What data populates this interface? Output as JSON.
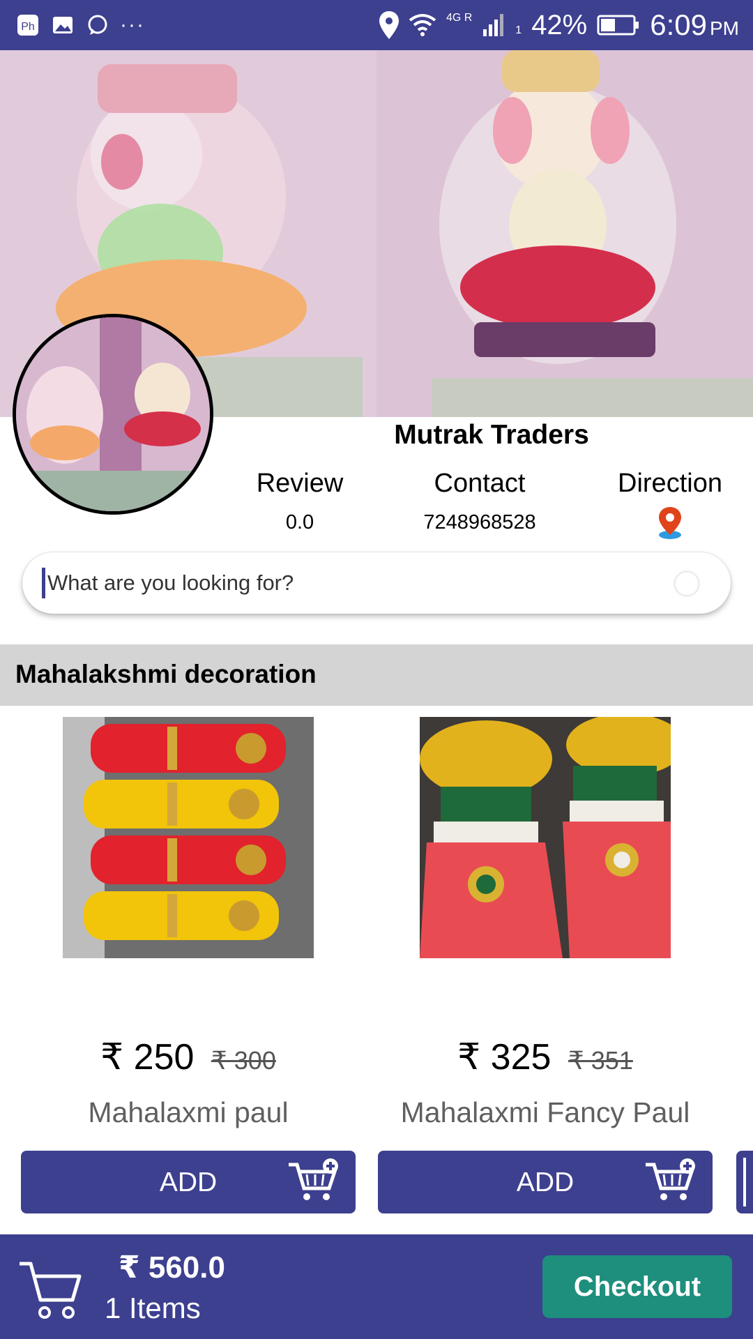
{
  "status_bar": {
    "network": "4G R",
    "sim_slot": "1",
    "battery": "42%",
    "time": "6:09",
    "ampm": "PM",
    "left_icons": [
      "photo-icon",
      "image-icon",
      "whatsapp-icon",
      "more-dots-icon"
    ],
    "more": "···"
  },
  "shop": {
    "name": "Mutrak Traders",
    "review_label": "Review",
    "review_value": "0.0",
    "contact_label": "Contact",
    "contact_value": "7248968528",
    "direction_label": "Direction"
  },
  "search": {
    "placeholder": "What are you looking for?"
  },
  "category": {
    "title": "Mahalakshmi decoration"
  },
  "products": [
    {
      "price": "₹ 250",
      "mrp": "₹ 300",
      "name": "Mahalaxmi paul",
      "add_label": "ADD"
    },
    {
      "price": "₹ 325",
      "mrp": "₹ 351",
      "name": "Mahalaxmi Fancy Paul",
      "add_label": "ADD"
    }
  ],
  "cart": {
    "total": "₹ 560.0",
    "items": "1 Items",
    "checkout_label": "Checkout"
  },
  "colors": {
    "primary": "#3d3f8f",
    "checkout": "#1e8e7d",
    "category_bg": "#d4d4d4"
  }
}
